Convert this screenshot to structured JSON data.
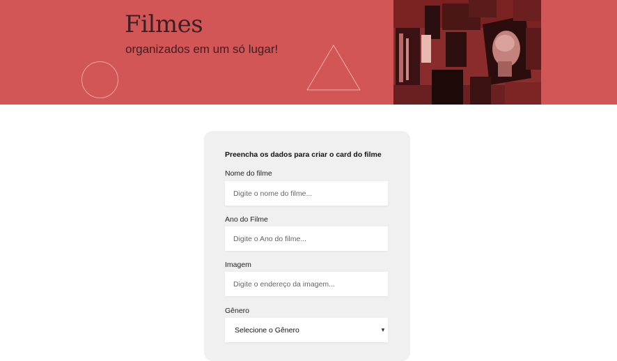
{
  "hero": {
    "title": "Filmes",
    "subtitle": "organizados em um só lugar!",
    "background": "#d35656"
  },
  "form": {
    "heading": "Preencha os dados para criar o card do filme",
    "fields": [
      {
        "label": "Nome do filme",
        "placeholder": "Digite o nome do filme..."
      },
      {
        "label": "Ano do Filme",
        "placeholder": "Digite o Ano do filme..."
      },
      {
        "label": "Imagem",
        "placeholder": "Digite o endereço da imagem..."
      }
    ],
    "genre": {
      "label": "Gênero",
      "selected": "Selecione o Gênero",
      "icon": "chevron-down-icon"
    }
  }
}
